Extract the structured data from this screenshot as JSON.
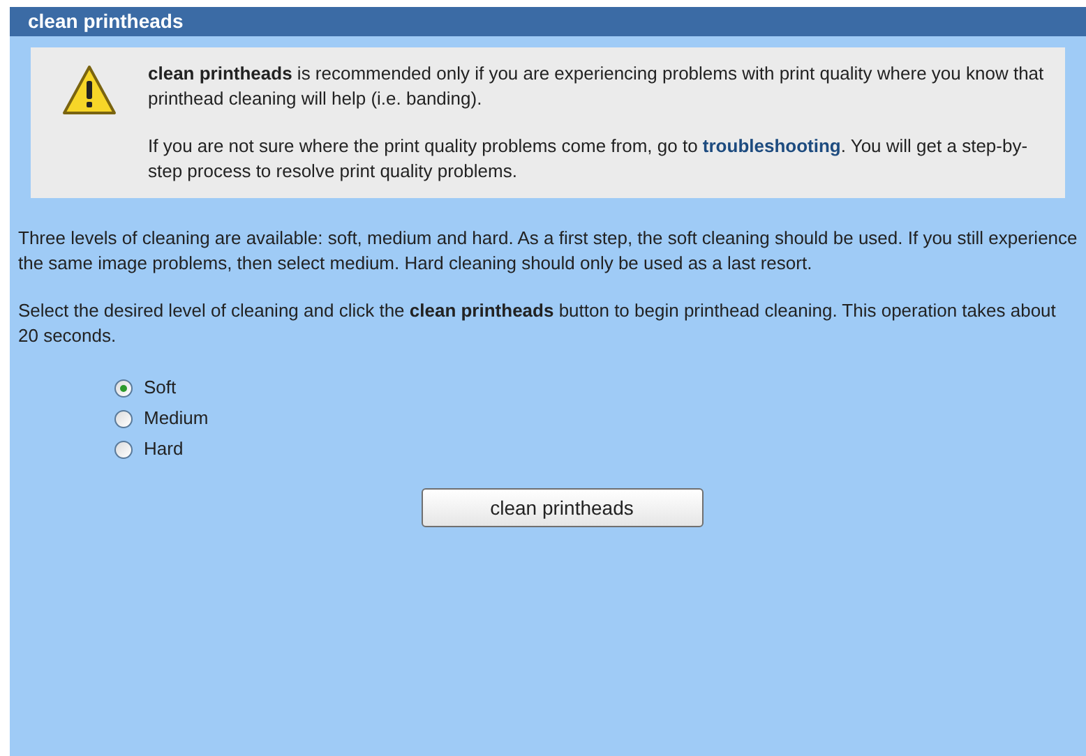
{
  "title": "clean printheads",
  "notice": {
    "paragraph": "**clean printheads** is recommended only if you are experiencing problems with print quality where you know that printhead cleaning will help (i.e. banding).",
    "help": {
      "before": "If you are not sure where the print quality problems come from, go to ",
      "link": "troubleshooting",
      "after": ". You will get a step-by-step process to resolve print quality problems."
    }
  },
  "paragraphs": [
    "Three levels of cleaning are available: soft, medium and hard. As a first step, the soft cleaning should be used. If you still experience the same image problems, then select medium. Hard cleaning should only be used as a last resort.",
    "Select the desired level of cleaning and click the **clean printheads** button to begin printhead cleaning. This operation takes about 20 seconds."
  ],
  "levels": [
    {
      "label": "Soft",
      "selected": true
    },
    {
      "label": "Medium",
      "selected": false
    },
    {
      "label": "Hard",
      "selected": false
    }
  ],
  "button": "clean printheads"
}
